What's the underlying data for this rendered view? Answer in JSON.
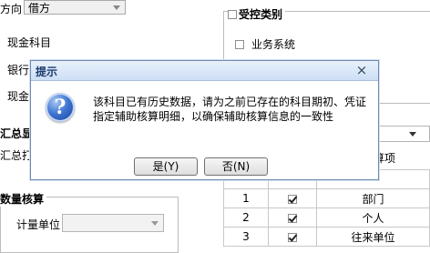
{
  "form": {
    "direction_label": "方向",
    "direction_value": "借方",
    "cash_subject_label": "现金科目",
    "bank_label": "银行",
    "cash_label_partial": "现金",
    "aux_display_label": "汇总显",
    "aux_print_label": "汇总打印",
    "quantity_title": "数量核算",
    "unit_label": "计量单位",
    "unit_value": ""
  },
  "control_group": {
    "title": "受控类别",
    "business_system_label": "业务系统"
  },
  "table": {
    "header_tail": "算项",
    "rows": [
      {
        "num": "1",
        "checked": true,
        "name": "部门"
      },
      {
        "num": "2",
        "checked": true,
        "name": "个人"
      },
      {
        "num": "3",
        "checked": true,
        "name": "往来单位"
      }
    ]
  },
  "dialog": {
    "title": "提示",
    "close_glyph": "×",
    "icon_glyph": "?",
    "message": "该科目已有历史数据，请为之前已存在的科目期初、凭证指定辅助核算明细，以确保辅助核算信息的一致性",
    "yes_label": "是(Y)",
    "no_label": "否(N)"
  }
}
